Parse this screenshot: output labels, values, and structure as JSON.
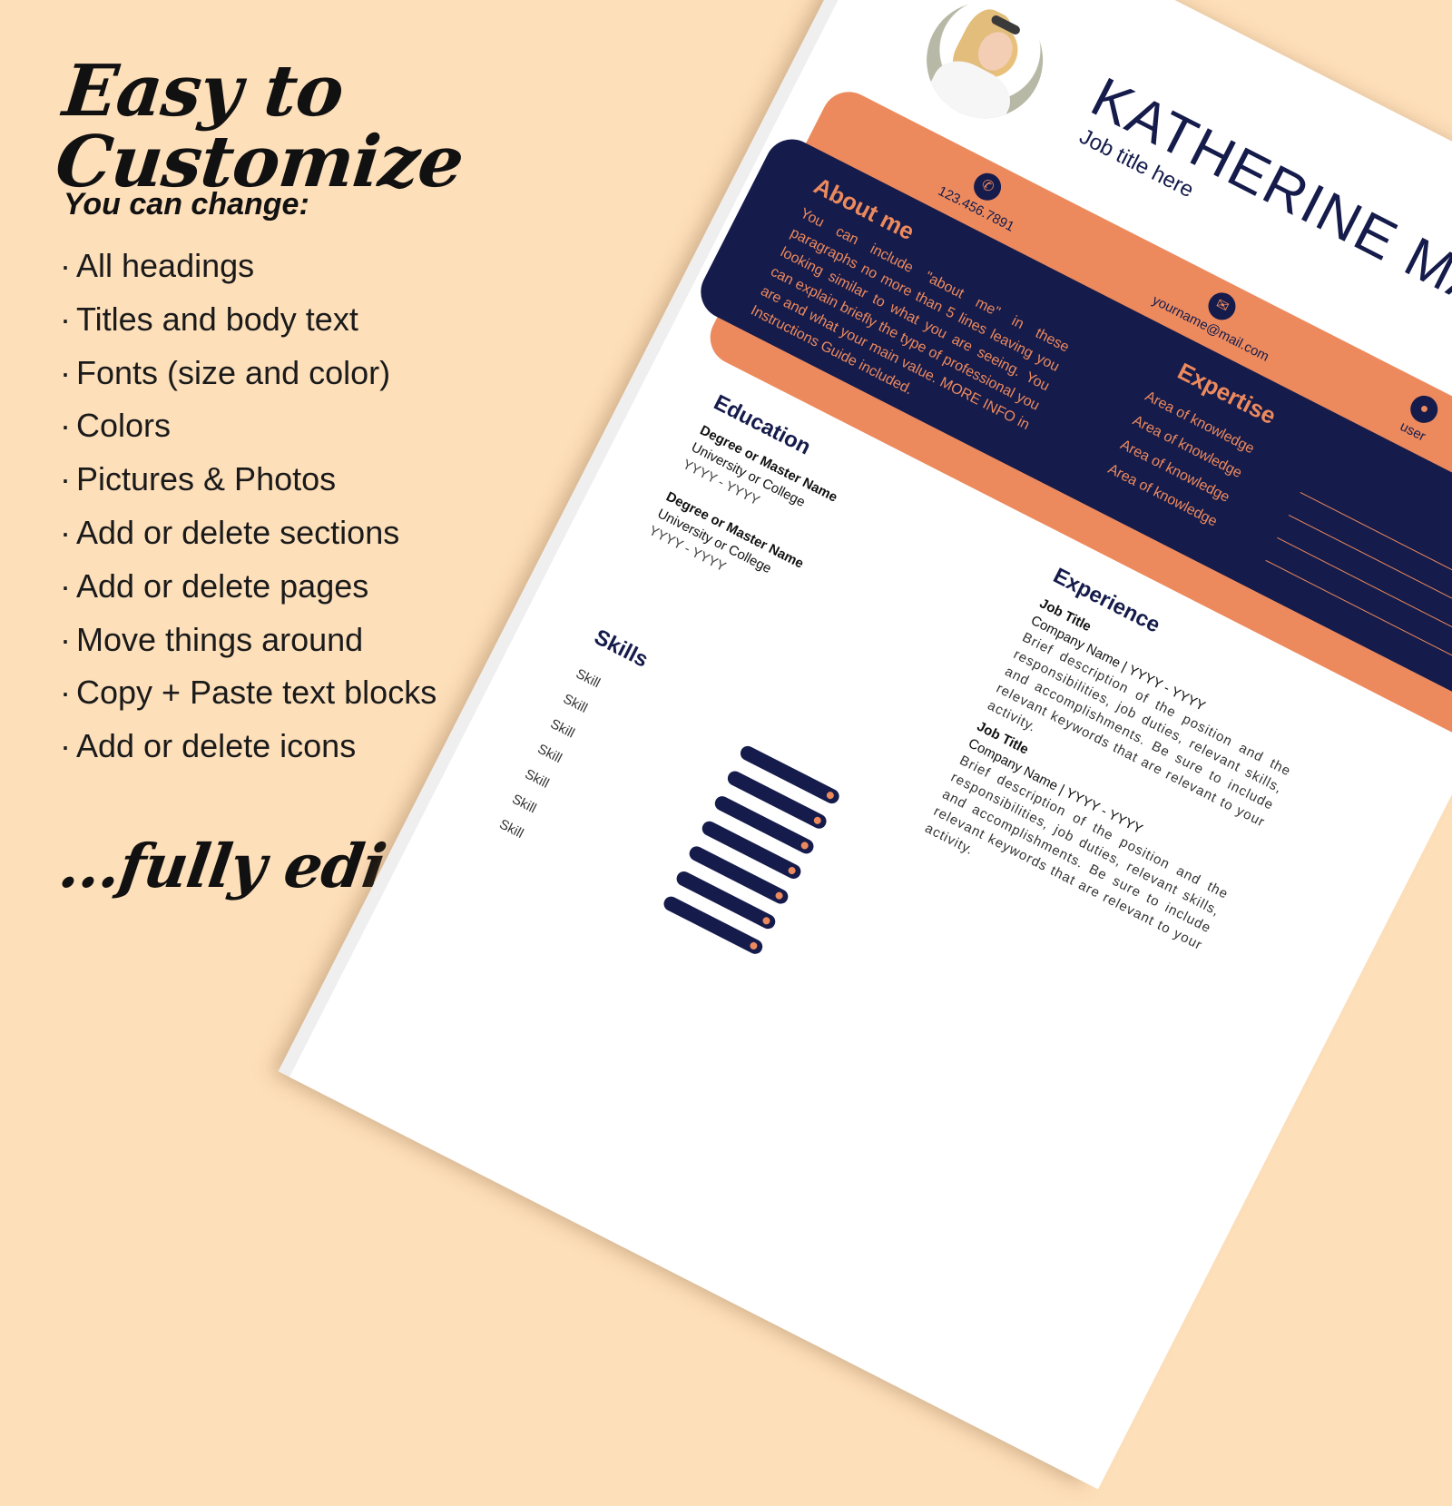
{
  "promo": {
    "headline": "Easy to Customize",
    "subheading": "You can change:",
    "bullet": "·",
    "features": [
      "All headings",
      "Titles and body text",
      "Fonts (size and color)",
      "Colors",
      "Pictures & Photos",
      "Add or delete sections",
      "Add or delete pages",
      "Move things around",
      "Copy + Paste text blocks",
      "Add or delete icons"
    ],
    "footer": "...fully editable!"
  },
  "colors": {
    "background": "#fddfba",
    "navy": "#151b4b",
    "orange": "#ec8a5e"
  },
  "resume": {
    "name": "KATHERINE MA",
    "job_title": "Job title here",
    "contacts": {
      "phone": {
        "icon": "phone-icon",
        "value": "123.456.7891"
      },
      "email": {
        "icon": "envelope-icon",
        "value": "yourname@mail.com"
      },
      "user": {
        "icon": "user-icon",
        "value": "user"
      }
    },
    "about": {
      "heading": "About me",
      "text": "You can include \"about me\" in these paragraphs no more than 5 lines leaving you looking similar to what you are seeing. You can explain briefly the type of professional you are and what your main value. MORE INFO in Instructions Guide included."
    },
    "expertise": {
      "heading": "Expertise",
      "items": [
        "Area of knowledge",
        "Area of knowledge",
        "Area of knowledge",
        "Area of knowledge"
      ]
    },
    "education": {
      "heading": "Education",
      "items": [
        {
          "degree": "Degree or Master Name",
          "school": "University or College",
          "years": "YYYY - YYYY"
        },
        {
          "degree": "Degree or Master Name",
          "school": "University or College",
          "years": "YYYY - YYYY"
        }
      ]
    },
    "skills": {
      "heading": "Skills",
      "items": [
        "Skill",
        "Skill",
        "Skill",
        "Skill",
        "Skill",
        "Skill",
        "Skill"
      ]
    },
    "experience": {
      "heading": "Experience",
      "items": [
        {
          "title": "Job Title",
          "company": "Company Name | YYYY - YYYY",
          "description": "Brief description of the position and the responsibilities, job duties, relevant skills, and accomplishments. Be sure to include relevant keywords that are relevant to your activity."
        },
        {
          "title": "Job Title",
          "company": "Company Name | YYYY - YYYY",
          "description": "Brief description of the position and the responsibilities, job duties, relevant skills, and accomplishments. Be sure to include relevant keywords that are relevant to your activity."
        }
      ]
    }
  }
}
